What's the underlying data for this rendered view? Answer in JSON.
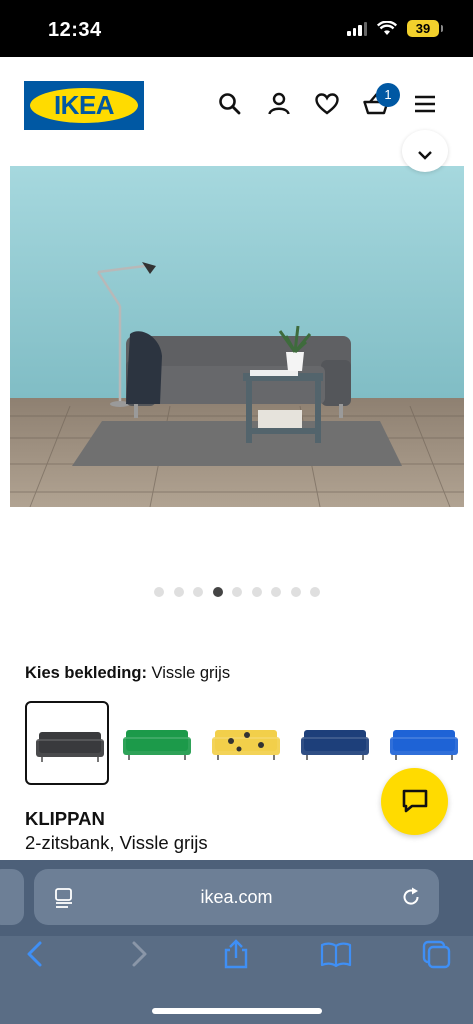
{
  "status_bar": {
    "time": "12:34",
    "battery": "39"
  },
  "header": {
    "logo_text": "IKEA",
    "cart_count": "1",
    "brand_blue": "#0058a3",
    "brand_yellow": "#ffdb00"
  },
  "gallery": {
    "dot_count": 9,
    "active_index": 3
  },
  "fabric": {
    "label": "Kies bekleding:",
    "value": "Vissle grijs",
    "swatches": [
      {
        "name": "Vissle grijs",
        "color": "#3a3b3d",
        "selected": true
      },
      {
        "name": "green",
        "color": "#1c9a4a",
        "selected": false
      },
      {
        "name": "yellow-patterned",
        "color": "#f2cf4a",
        "selected": false
      },
      {
        "name": "dark-blue",
        "color": "#1d3f7a",
        "selected": false
      },
      {
        "name": "bright-blue",
        "color": "#1e63d6",
        "selected": false
      }
    ]
  },
  "product": {
    "name": "KLIPPAN",
    "description": "2-zitsbank, Vissle grijs"
  },
  "safari": {
    "url": "ikea.com"
  }
}
